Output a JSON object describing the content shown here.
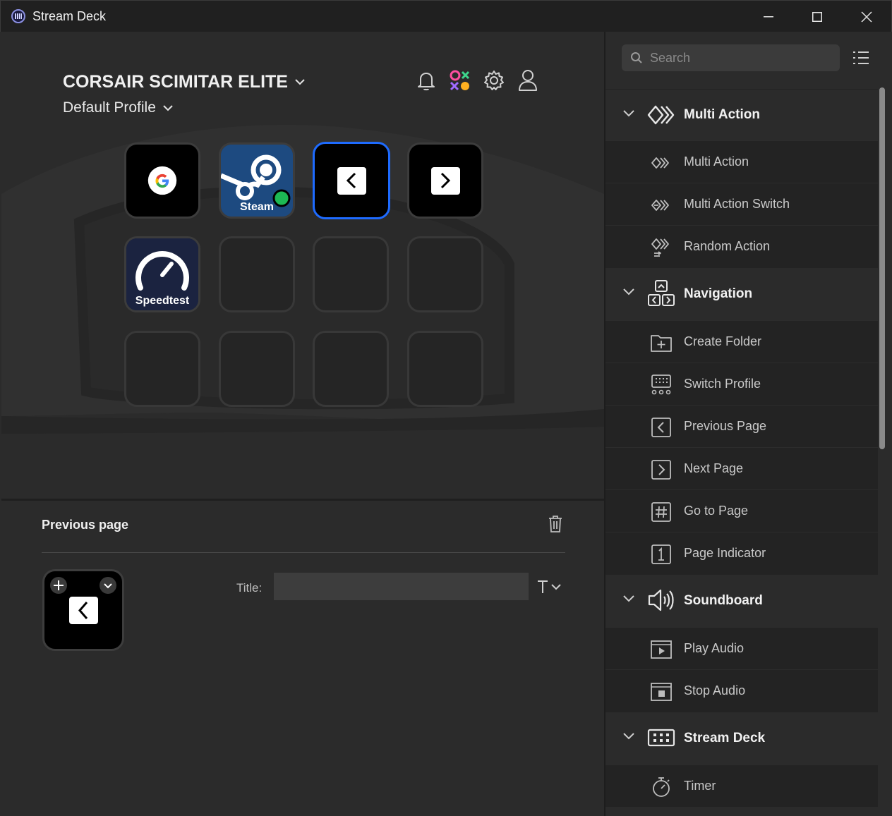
{
  "window": {
    "title": "Stream Deck"
  },
  "device": {
    "name": "CORSAIR SCIMITAR ELITE",
    "profile": "Default Profile"
  },
  "keys": {
    "google": "Google",
    "steam_label": "Steam",
    "speedtest_label": "Speedtest"
  },
  "properties": {
    "heading": "Previous page",
    "title_label": "Title:",
    "title_value": ""
  },
  "search": {
    "placeholder": "Search"
  },
  "categories": [
    {
      "label": "Multi Action",
      "items": [
        "Multi Action",
        "Multi Action Switch",
        "Random Action"
      ]
    },
    {
      "label": "Navigation",
      "items": [
        "Create Folder",
        "Switch Profile",
        "Previous Page",
        "Next Page",
        "Go to Page",
        "Page Indicator"
      ]
    },
    {
      "label": "Soundboard",
      "items": [
        "Play Audio",
        "Stop Audio"
      ]
    },
    {
      "label": "Stream Deck",
      "items": [
        "Timer"
      ]
    }
  ],
  "colors": {
    "accent": "#1e6bff",
    "background": "#2b2b2b",
    "titlebar": "#202020",
    "steam_badge": "#1db954"
  }
}
